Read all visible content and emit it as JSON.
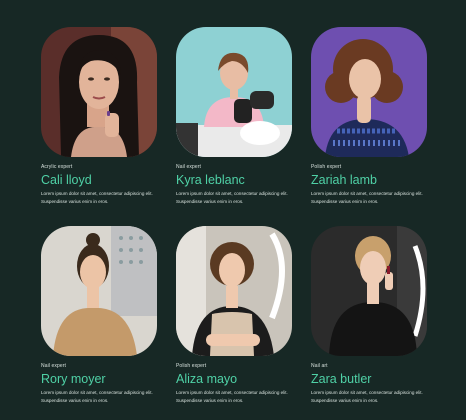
{
  "team": [
    {
      "role": "Acrylic expert",
      "name": "Cali lloyd",
      "desc": "Lorem ipsum dolor sit amet, consectetur adipiscing elit. Suspendisse varius enim in eros.",
      "bg": "#5a2e2a"
    },
    {
      "role": "Nail expert",
      "name": "Kyra leblanc",
      "desc": "Lorem ipsum dolor sit amet, consectetur adipiscing elit. Suspendisse varius enim in eros.",
      "bg": "#8ed1d3"
    },
    {
      "role": "Polish expert",
      "name": "Zariah lamb",
      "desc": "Lorem ipsum dolor sit amet, consectetur adipiscing elit. Suspendisse varius enim in eros.",
      "bg": "#6e4fb0"
    },
    {
      "role": "Nail expert",
      "name": "Rory moyer",
      "desc": "Lorem ipsum dolor sit amet, consectetur adipiscing elit. Suspendisse varius enim in eros.",
      "bg": "#d9d6cf"
    },
    {
      "role": "Polish expert",
      "name": "Aliza mayo",
      "desc": "Lorem ipsum dolor sit amet, consectetur adipiscing elit. Suspendisse varius enim in eros.",
      "bg": "#c9c4bb"
    },
    {
      "role": "Nail art",
      "name": "Zara butler",
      "desc": "Lorem ipsum dolor sit amet, consectetur adipiscing elit. Suspendisse varius enim in eros.",
      "bg": "#2b2b2b"
    }
  ],
  "colors": {
    "page_bg": "#172825",
    "accent": "#4fd1a6",
    "text": "#d6e0dc"
  }
}
